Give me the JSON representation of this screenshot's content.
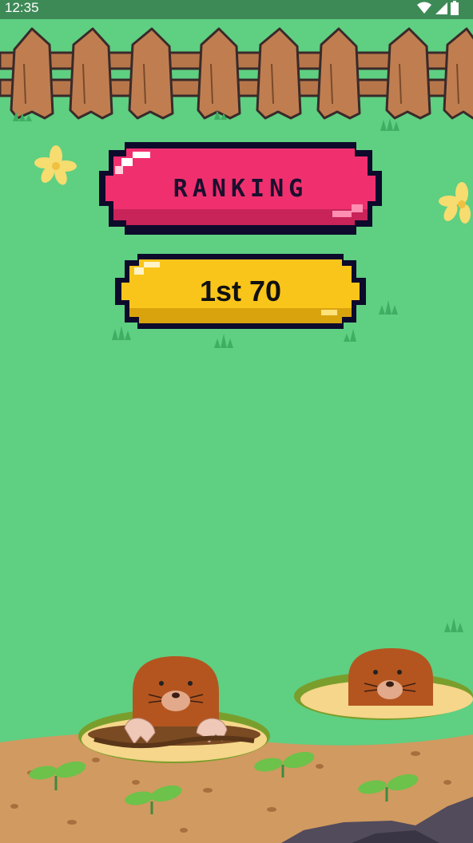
{
  "status_bar": {
    "time": "12:35",
    "icons": [
      "wifi-icon",
      "cellular-signal-icon",
      "battery-icon"
    ]
  },
  "menu": {
    "ranking_label": "RANKING",
    "score_label": "1st 70"
  },
  "colors": {
    "grass": "#5fcf82",
    "ranking_button": "#f0306e",
    "score_button": "#f9c51a",
    "outline": "#0d0a2b",
    "soil": "#d19a60",
    "mole": "#b4551f"
  }
}
